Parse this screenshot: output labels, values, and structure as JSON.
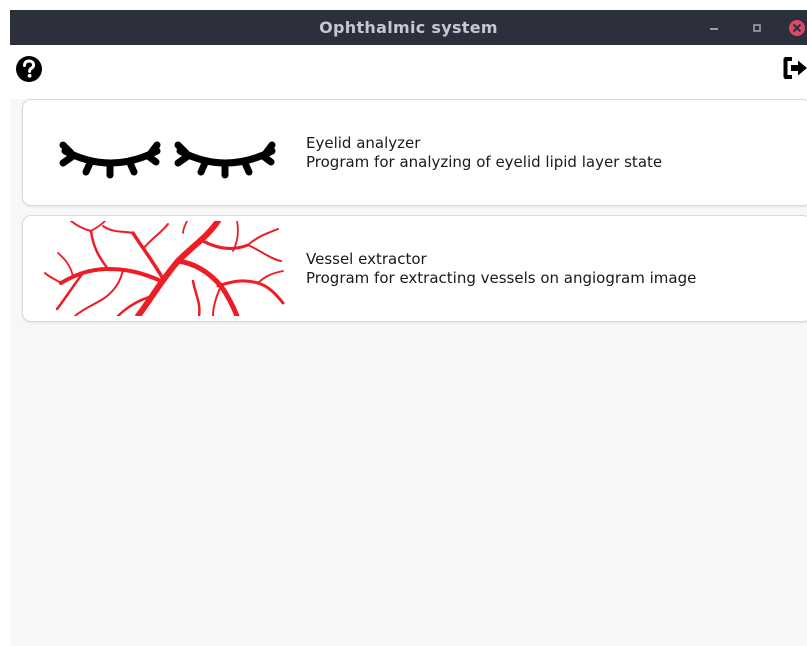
{
  "window": {
    "title": "Ophthalmic system",
    "controls": [
      "minimize-icon",
      "maximize-icon",
      "close-icon"
    ],
    "accent_close": "#e0466a"
  },
  "toolbar": {
    "help_icon": "question-circle-icon",
    "logout_icon": "sign-out-icon"
  },
  "programs": [
    {
      "name": "Eyelid analyzer",
      "description": "Program for analyzing of eyelid lipid layer state",
      "icon": "closed-eyes-icon",
      "icon_color": "#000000"
    },
    {
      "name": "Vessel extractor",
      "description": "Program for extracting vessels on angiogram image",
      "icon": "blood-vessels-icon",
      "icon_color": "#ee1c25"
    }
  ]
}
